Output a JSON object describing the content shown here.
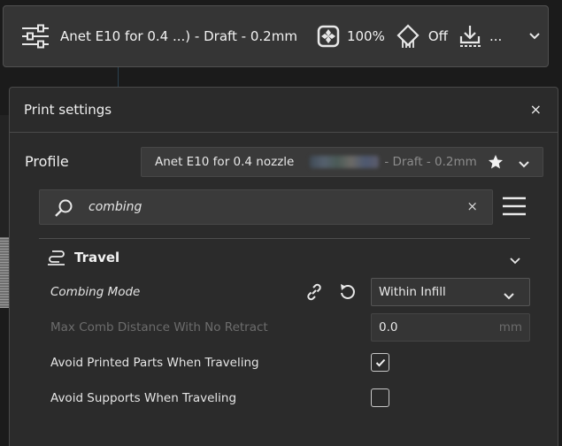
{
  "topbar": {
    "printer_label": "Anet E10 for 0.4 ...) - Draft - 0.2mm",
    "infill_value": "100%",
    "support_value": "Off",
    "adhesion_value": "...",
    "icons": [
      "settings-sliders-icon",
      "infill-icon",
      "support-icon",
      "adhesion-icon",
      "chevron-down-icon"
    ]
  },
  "panel": {
    "title": "Print settings",
    "close_label": "×",
    "profile": {
      "label": "Profile",
      "name": "Anet E10 for 0.4 nozzle",
      "quality": "- Draft - 0.2mm"
    },
    "search": {
      "value": "combing",
      "clear_label": "×"
    },
    "category": {
      "title": "Travel"
    },
    "settings": [
      {
        "label": "Combing Mode",
        "value": "Within Infill"
      },
      {
        "label": "Max Comb Distance With No Retract",
        "value": "0.0",
        "unit": "mm"
      },
      {
        "label": "Avoid Printed Parts When Traveling",
        "checked": true
      },
      {
        "label": "Avoid Supports When Traveling",
        "checked": false
      }
    ]
  },
  "colors": {
    "background": "#1b1b1b",
    "panel": "#2b2b2b",
    "topbar": "#353535",
    "text": "#e8e8e8",
    "muted": "#6c6c6c"
  }
}
